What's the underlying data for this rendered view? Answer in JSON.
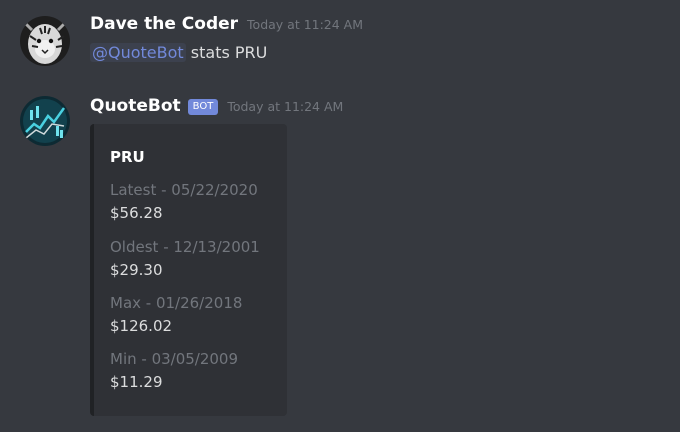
{
  "messages": [
    {
      "author": "Dave the Coder",
      "timestamp": "Today at 11:24 AM",
      "mention": "@QuoteBot",
      "text": "stats PRU"
    },
    {
      "author": "QuoteBot",
      "tag": "BOT",
      "timestamp": "Today at 11:24 AM",
      "embed": {
        "title": "PRU",
        "fields": [
          {
            "name": "Latest - 05/22/2020",
            "value": "$56.28"
          },
          {
            "name": "Oldest - 12/13/2001",
            "value": "$29.30"
          },
          {
            "name": "Max - 01/26/2018",
            "value": "$126.02"
          },
          {
            "name": "Min - 03/05/2009",
            "value": "$11.29"
          }
        ]
      }
    }
  ],
  "colors": {
    "background": "#36393f",
    "embed_background": "#2f3136",
    "mention": "#7289da",
    "bot_tag": "#7289da",
    "muted": "#72767d"
  },
  "icons": {
    "user_avatar": "tiger-avatar-icon",
    "bot_avatar": "stock-chart-avatar-icon"
  }
}
